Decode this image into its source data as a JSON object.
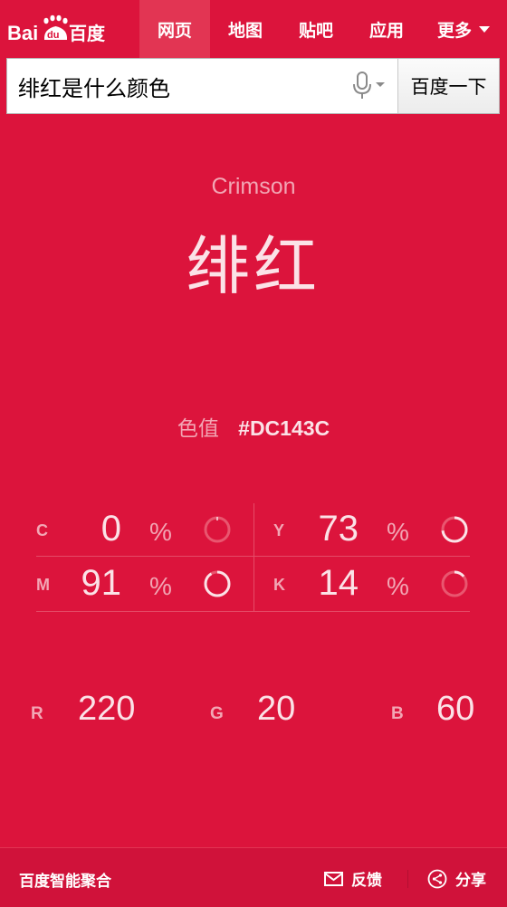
{
  "header": {
    "logo": "Bai百度",
    "nav": [
      {
        "label": "网页",
        "active": true
      },
      {
        "label": "地图",
        "active": false
      },
      {
        "label": "贴吧",
        "active": false
      },
      {
        "label": "应用",
        "active": false
      },
      {
        "label": "更多",
        "active": false
      }
    ]
  },
  "search": {
    "query": "绯红是什么颜色",
    "button_label": "百度一下",
    "mic_icon": "microphone-icon"
  },
  "color": {
    "english_name": "Crimson",
    "chinese_name": "绯红",
    "hex_label": "色值",
    "hex_value": "#DC143C",
    "swatch": "#DC143C"
  },
  "cmyk": [
    {
      "letter": "C",
      "value": "0",
      "unit": "%",
      "fraction": 0.0
    },
    {
      "letter": "Y",
      "value": "73",
      "unit": "%",
      "fraction": 0.73
    },
    {
      "letter": "M",
      "value": "91",
      "unit": "%",
      "fraction": 0.91
    },
    {
      "letter": "K",
      "value": "14",
      "unit": "%",
      "fraction": 0.14
    }
  ],
  "rgb": [
    {
      "letter": "R",
      "value": "220"
    },
    {
      "letter": "G",
      "value": "20"
    },
    {
      "letter": "B",
      "value": "60"
    }
  ],
  "footer": {
    "brand": "百度智能聚合",
    "feedback_label": "反馈",
    "share_label": "分享"
  }
}
